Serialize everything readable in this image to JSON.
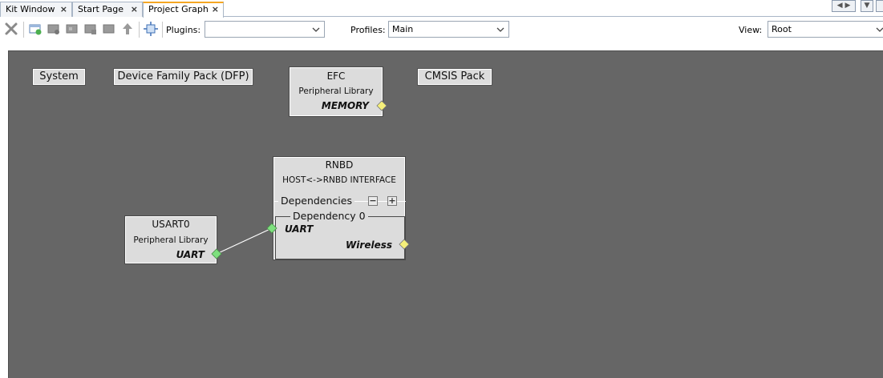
{
  "tabs": [
    {
      "label": "Kit Window",
      "close": "×"
    },
    {
      "label": "Start Page",
      "close": "×"
    },
    {
      "label": "Project Graph",
      "close": "×"
    }
  ],
  "toolbar": {
    "plugins_label": "Plugins:",
    "plugins_value": "",
    "profiles_label": "Profiles:",
    "profiles_value": "Main",
    "view_label": "View:",
    "view_value": "Root",
    "icons": [
      "delete-icon",
      "new-component-icon",
      "add-icon",
      "group-icon",
      "ungroup-icon",
      "collapse-icon",
      "move-up-icon",
      "auto-layout-icon"
    ]
  },
  "nav_buttons": {
    "prev": "◀",
    "next": "▶",
    "menu": "▼"
  },
  "canvas": {
    "background": "#666666",
    "groups": [
      {
        "label": "System"
      },
      {
        "label": "Device Family Pack (DFP)"
      },
      {
        "label": "CMSIS Pack"
      }
    ],
    "nodes": {
      "efc": {
        "title": "EFC",
        "subtitle": "Peripheral Library",
        "capability": "MEMORY"
      },
      "rnbd": {
        "title": "RNBD",
        "subtitle": "HOST<->RNBD INTERFACE",
        "dependencies_label": "Dependencies",
        "collapse": "−",
        "expand": "+",
        "dependency_label": "Dependency 0",
        "dependency_capability": "UART",
        "capability": "Wireless"
      },
      "usart0": {
        "title": "USART0",
        "subtitle": "Peripheral Library",
        "capability": "UART"
      }
    },
    "colors": {
      "provided_port": "#f6f07a",
      "connected_port": "#7ee07e"
    }
  }
}
